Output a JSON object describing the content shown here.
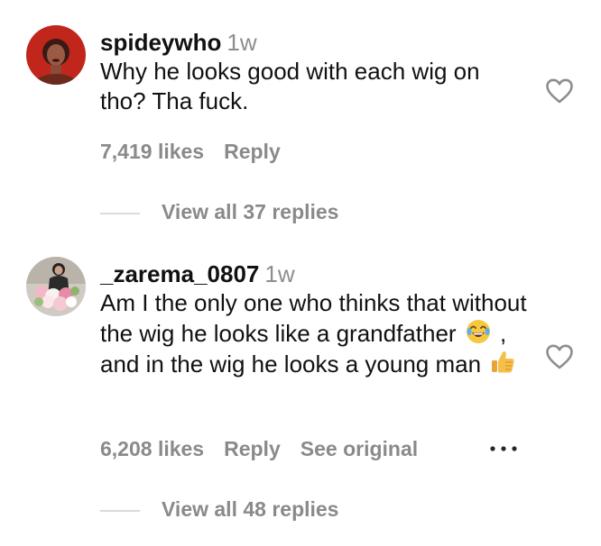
{
  "comments": [
    {
      "username": "spideywho",
      "time": "1w",
      "text": "Why he looks good with each wig on tho? Tha fuck.",
      "likes": "7,419 likes",
      "reply_label": "Reply",
      "view_replies": "View all 37 replies"
    },
    {
      "username": "_zarema_0807",
      "time": "1w",
      "text_part1": "Am I the only one who thinks that without the wig he looks like a grandfather",
      "text_part2": ", and in the wig he looks a young man",
      "likes": "6,208 likes",
      "reply_label": "Reply",
      "see_original": "See original",
      "view_replies": "View all 48 replies"
    }
  ],
  "icons": {
    "like": "heart-outline-icon",
    "more": "more-options-icon",
    "emoji_1": "face-with-tears-of-joy",
    "emoji_2": "thumbs-up"
  },
  "colors": {
    "text": "#111111",
    "secondary": "#8e8e8e",
    "divider": "#dbdbdb"
  }
}
